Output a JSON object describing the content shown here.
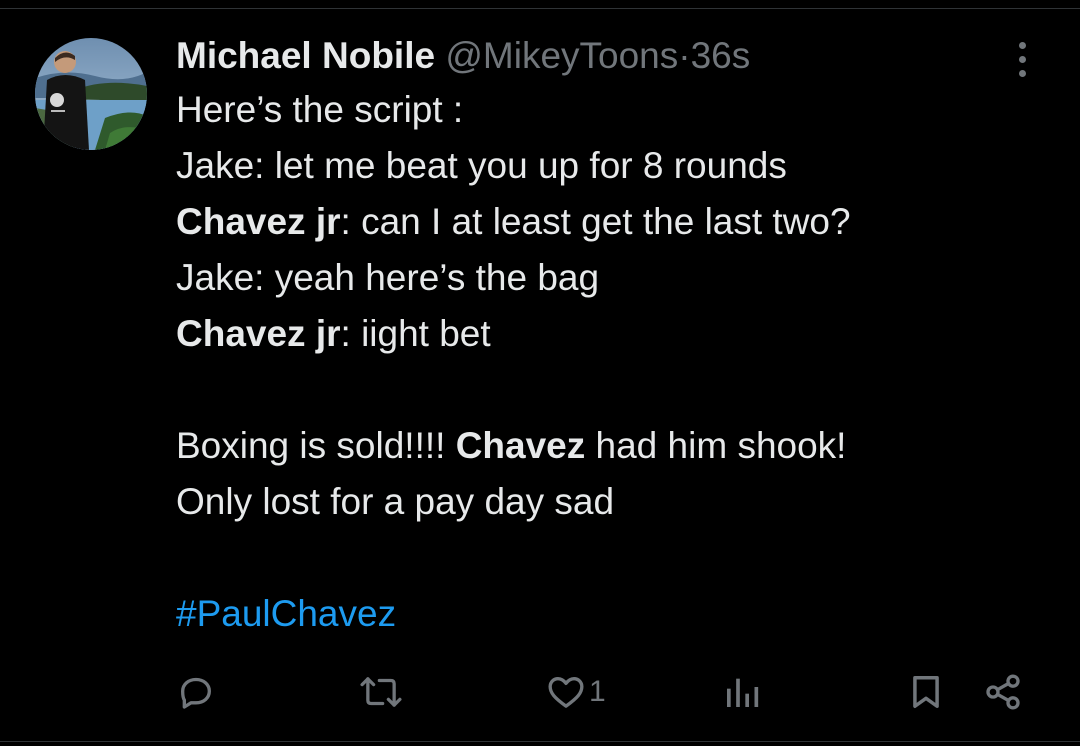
{
  "tweet": {
    "author_name": "Michael Nobile",
    "handle": "@MikeyToons",
    "separator": "·",
    "time": "36s",
    "lines": [
      {
        "bold": "",
        "rest": "Here’s the script :"
      },
      {
        "bold": "",
        "rest": "Jake: let me beat you up for 8 rounds"
      },
      {
        "bold": "Chavez jr",
        "rest": ": can I at least get the last two?"
      },
      {
        "bold": "",
        "rest": "Jake: yeah here’s the bag"
      },
      {
        "bold": "Chavez jr",
        "rest": ": iight bet"
      }
    ],
    "para2_line1_a": "Boxing is sold!!!! ",
    "para2_line1_bold": "Chavez",
    "para2_line1_b": " had him shook!",
    "para2_line2": "Only lost for a pay day sad",
    "hashtag": "#PaulChavez"
  },
  "actions": {
    "reply_icon": "reply-icon",
    "retweet_icon": "retweet-icon",
    "like_icon": "heart-icon",
    "like_count": "1",
    "views_icon": "views-icon",
    "bookmark_icon": "bookmark-icon",
    "share_icon": "share-icon"
  },
  "colors": {
    "background": "#000000",
    "text": "#e7e9ea",
    "muted": "#71767b",
    "link": "#1d9bf0"
  }
}
